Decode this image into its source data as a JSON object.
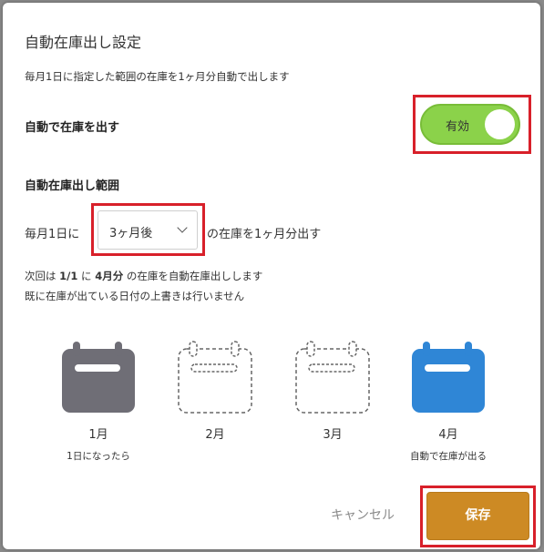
{
  "dialog": {
    "title": "自動在庫出し設定",
    "description": "毎月1日に指定した範囲の在庫を1ヶ月分自動で出します"
  },
  "auto_toggle": {
    "label": "自動で在庫を出す",
    "state_text": "有効",
    "enabled": true
  },
  "range": {
    "heading": "自動在庫出し範囲",
    "prefix": "毎月1日に",
    "selected": "3ヶ月後",
    "suffix": "の在庫を1ヶ月分出す"
  },
  "next_info": {
    "p1": "次回は ",
    "date": "1/1",
    "p2": " に ",
    "month": "4月分",
    "p3": " の在庫を自動在庫出しします",
    "note": "既に在庫が出ている日付の上書きは行いません"
  },
  "timeline": [
    {
      "month": "1月",
      "caption": "1日になったら",
      "style": "filled-gray"
    },
    {
      "month": "2月",
      "caption": "",
      "style": "dashed"
    },
    {
      "month": "3月",
      "caption": "",
      "style": "dashed"
    },
    {
      "month": "4月",
      "caption": "自動で在庫が出る",
      "style": "filled-blue"
    }
  ],
  "buttons": {
    "cancel": "キャンセル",
    "save": "保存"
  },
  "colors": {
    "toggle_on": "#8bd24a",
    "save": "#cd8a24",
    "highlight": "#d8202a",
    "calendar_gray": "#6f6e76",
    "calendar_blue": "#2f86d6"
  }
}
